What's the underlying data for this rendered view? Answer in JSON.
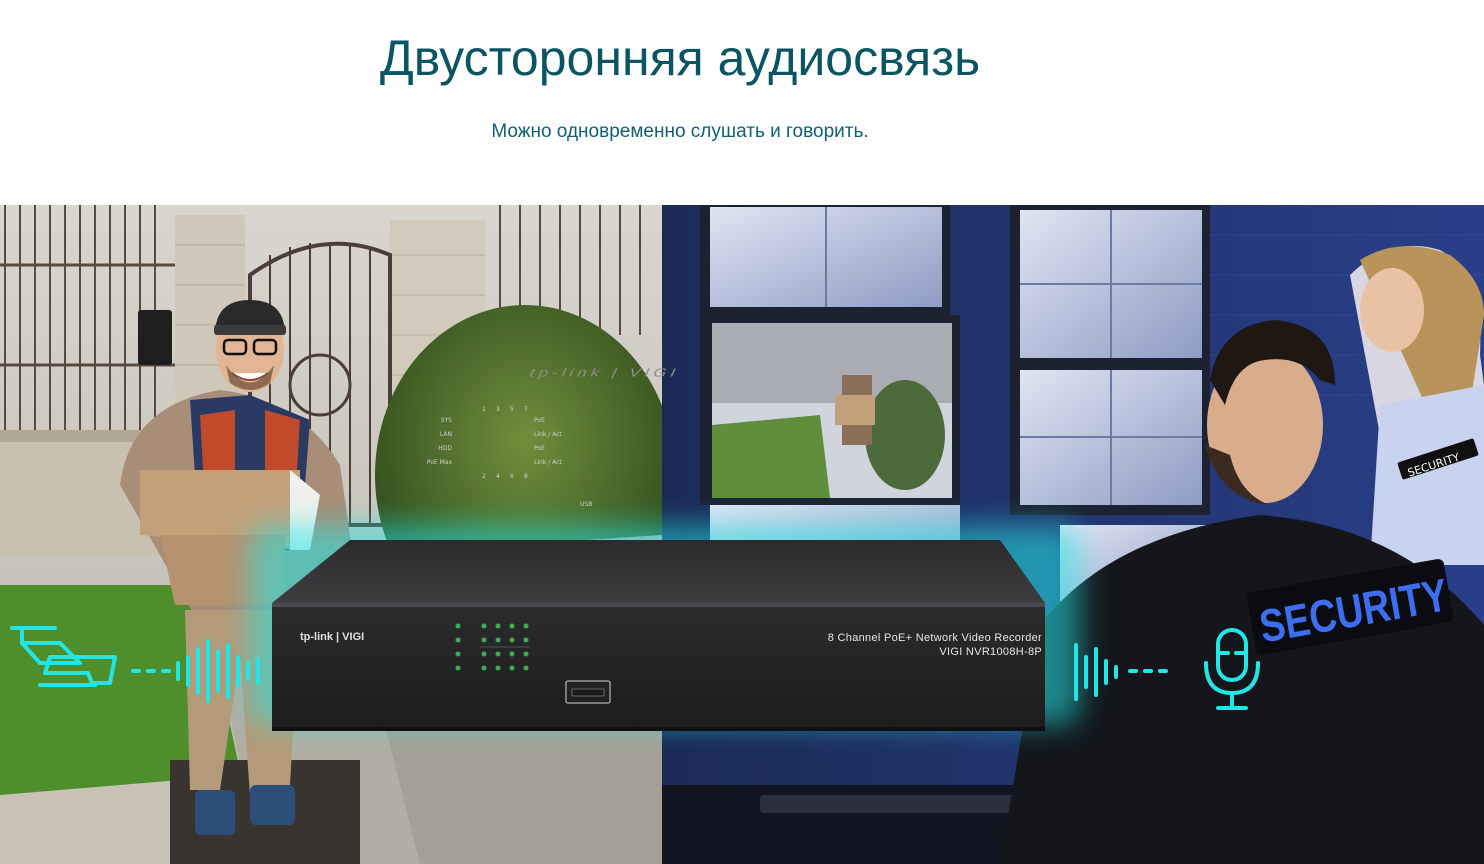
{
  "title": "Двусторонняя аудиосвязь",
  "subtitle": "Можно одновременно слушать и говорить.",
  "device": {
    "front_brand": "tp-link | VIGI",
    "top_brand": "tp-link | VIGI",
    "model_line1": "8 Channel PoE+ Network Video Recorder",
    "model_line2": "VIGI NVR1008H-8P",
    "led_labels": [
      "SYS",
      "LAN",
      "HDD",
      "PoE Max"
    ],
    "port_numbers_top": [
      "1",
      "3",
      "5",
      "7"
    ],
    "port_numbers_bottom": [
      "2",
      "4",
      "6",
      "8"
    ],
    "port_labels": [
      "PoE",
      "Link / Act",
      "PoE",
      "Link / Act"
    ],
    "usb_label": "USB"
  },
  "officer_patch": "SECURITY",
  "officer2_patch": "SECURITY",
  "icons": {
    "left": "camera-icon",
    "right": "microphone-icon"
  },
  "colors": {
    "title": "#0b5563",
    "accent_glow": "#22e6e6"
  }
}
